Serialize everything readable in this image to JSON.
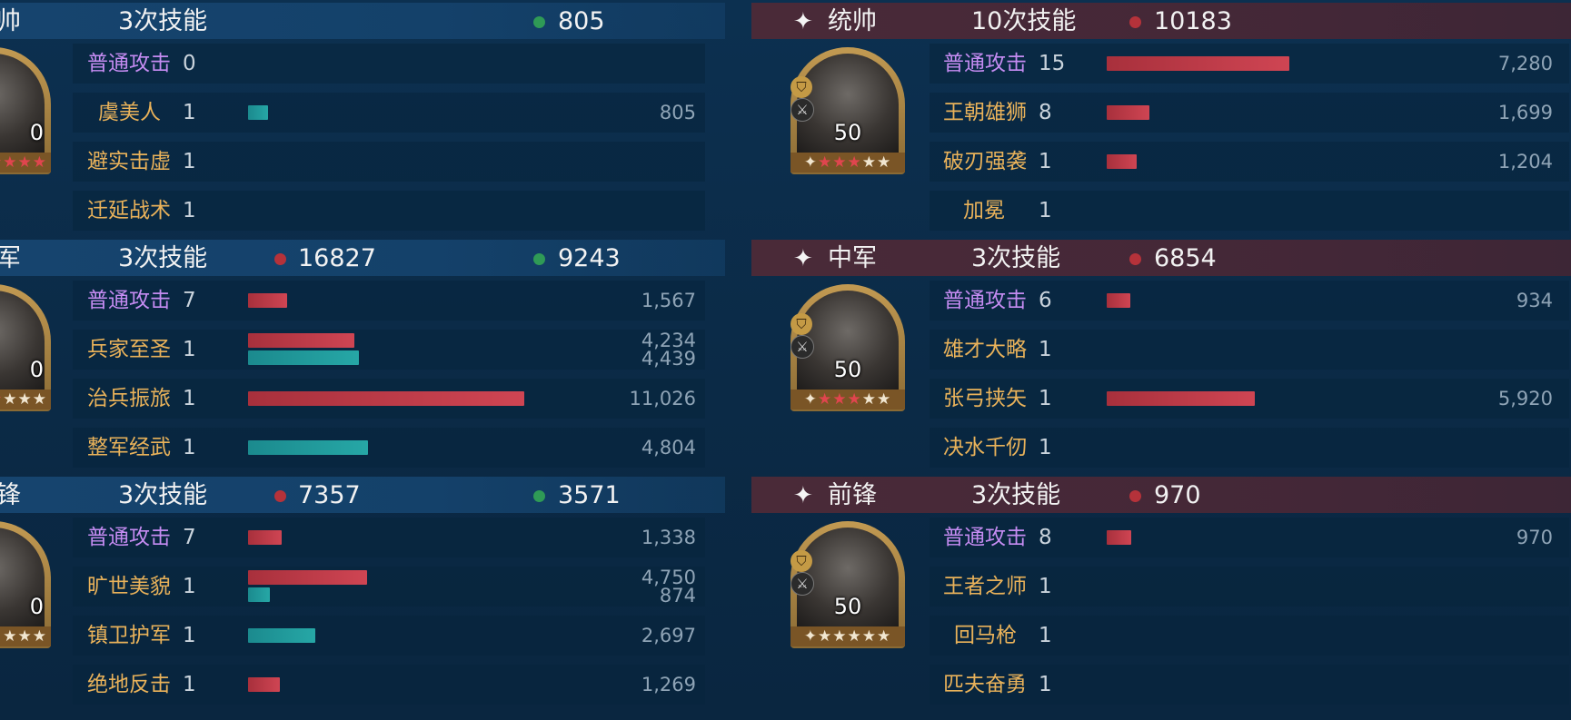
{
  "left": {
    "sections": [
      {
        "role": "帅",
        "skill_count": "3次技能",
        "red_total": "",
        "green_total": "805",
        "level": "0",
        "rows": [
          {
            "name": "普通攻击",
            "count": "0",
            "value": "",
            "value2": ""
          },
          {
            "name": "虞美人",
            "count": "1",
            "value": "805",
            "value2": ""
          },
          {
            "name": "避实击虚",
            "count": "1",
            "value": "",
            "value2": ""
          },
          {
            "name": "迁延战术",
            "count": "1",
            "value": "",
            "value2": ""
          }
        ]
      },
      {
        "role": "军",
        "skill_count": "3次技能",
        "red_total": "16827",
        "green_total": "9243",
        "level": "0",
        "rows": [
          {
            "name": "普通攻击",
            "count": "7",
            "value": "1,567",
            "value2": ""
          },
          {
            "name": "兵家至圣",
            "count": "1",
            "value": "4,234",
            "value2": "4,439"
          },
          {
            "name": "治兵振旅",
            "count": "1",
            "value": "11,026",
            "value2": ""
          },
          {
            "name": "整军经武",
            "count": "1",
            "value": "4,804",
            "value2": ""
          }
        ]
      },
      {
        "role": "锋",
        "skill_count": "3次技能",
        "red_total": "7357",
        "green_total": "3571",
        "level": "0",
        "rows": [
          {
            "name": "普通攻击",
            "count": "7",
            "value": "1,338",
            "value2": ""
          },
          {
            "name": "旷世美貌",
            "count": "1",
            "value": "4,750",
            "value2": "874"
          },
          {
            "name": "镇卫护军",
            "count": "1",
            "value": "2,697",
            "value2": ""
          },
          {
            "name": "绝地反击",
            "count": "1",
            "value": "1,269",
            "value2": ""
          }
        ]
      }
    ]
  },
  "right": {
    "sections": [
      {
        "star_icon": "✦",
        "role": "统帅",
        "skill_count": "10次技能",
        "red_total": "10183",
        "level": "50",
        "rows": [
          {
            "name": "普通攻击",
            "count": "15",
            "value": "7,280"
          },
          {
            "name": "王朝雄狮",
            "count": "8",
            "value": "1,699"
          },
          {
            "name": "破刃强袭",
            "count": "1",
            "value": "1,204"
          },
          {
            "name": "加冕",
            "count": "1",
            "value": ""
          }
        ]
      },
      {
        "star_icon": "✦",
        "role": "中军",
        "skill_count": "3次技能",
        "red_total": "6854",
        "level": "50",
        "rows": [
          {
            "name": "普通攻击",
            "count": "6",
            "value": "934"
          },
          {
            "name": "雄才大略",
            "count": "1",
            "value": ""
          },
          {
            "name": "张弓挟矢",
            "count": "1",
            "value": "5,920"
          },
          {
            "name": "决水千仞",
            "count": "1",
            "value": ""
          }
        ]
      },
      {
        "star_icon": "✦",
        "role": "前锋",
        "skill_count": "3次技能",
        "red_total": "970",
        "level": "50",
        "rows": [
          {
            "name": "普通攻击",
            "count": "8",
            "value": "970"
          },
          {
            "name": "王者之师",
            "count": "1",
            "value": ""
          },
          {
            "name": "回马枪",
            "count": "1",
            "value": ""
          },
          {
            "name": "匹夫奋勇",
            "count": "1",
            "value": ""
          }
        ]
      }
    ]
  },
  "bars": {
    "scale_max": 11026,
    "left": [
      [
        [],
        [
          [
            "teal",
            805
          ]
        ],
        [],
        []
      ],
      [
        [
          [
            "red",
            1567
          ]
        ],
        [
          [
            "red",
            4234
          ],
          [
            "teal",
            4439
          ]
        ],
        [
          [
            "red",
            11026
          ]
        ],
        [
          [
            "teal",
            4804
          ]
        ]
      ],
      [
        [
          [
            "red",
            1338
          ]
        ],
        [
          [
            "red",
            4750
          ],
          [
            "teal",
            874
          ]
        ],
        [
          [
            "teal",
            2697
          ]
        ],
        [
          [
            "red",
            1269
          ]
        ]
      ]
    ],
    "right": [
      [
        [
          [
            "red",
            7280
          ]
        ],
        [
          [
            "red",
            1699
          ]
        ],
        [
          [
            "red",
            1204
          ]
        ],
        []
      ],
      [
        [
          [
            "red",
            934
          ]
        ],
        [],
        [
          [
            "red",
            5920
          ]
        ],
        []
      ],
      [
        [
          [
            "red",
            970
          ]
        ],
        [],
        [],
        []
      ]
    ]
  },
  "colors": {
    "skill_gold": "#e9b25a",
    "skill_purple": "#c58cf2",
    "bar_red": "#c23c49",
    "bar_teal": "#22a0a0",
    "dot_red": "#b5323a",
    "dot_green": "#2f9a56"
  }
}
